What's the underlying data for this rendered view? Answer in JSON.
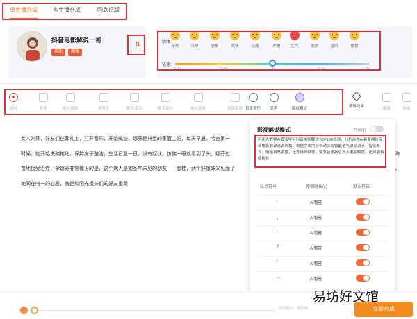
{
  "tabs": [
    "单主播合成",
    "多主播合成",
    "回到旧版"
  ],
  "profile": {
    "name": "抖音电影解说一哥",
    "badges": [
      "高能",
      "顺德"
    ],
    "swap_icon": "swap-arrows-icon"
  },
  "emotion": {
    "label": "情绪:",
    "items": [
      {
        "label": "亲切",
        "color": "#f5c242"
      },
      {
        "label": "冷静",
        "color": "#f5c242"
      },
      {
        "label": "恐惧",
        "color": "#f5c242"
      },
      {
        "label": "欢快",
        "color": "#f5c242"
      },
      {
        "label": "轻蔑",
        "color": "#f5c242"
      },
      {
        "label": "严肃",
        "color": "#f5c242"
      },
      {
        "label": "生气",
        "color": "#e9484d"
      },
      {
        "label": "悲伤",
        "color": "#f5c242"
      },
      {
        "label": "温柔",
        "color": "#f5c242"
      },
      {
        "label": "愉悦",
        "color": "#f5c242"
      }
    ],
    "selected_index": 6
  },
  "speed": {
    "label": "语速:",
    "ticks": [
      "0.1x",
      "0.5x",
      "1x",
      "1.5x",
      "2x"
    ],
    "value": "1x"
  },
  "toolbar": [
    {
      "label": "试听",
      "icon": "record-icon"
    },
    {
      "label": "暂停",
      "icon": "pause-icon"
    },
    {
      "label": "插入停顿",
      "icon": "insert-pause-icon"
    },
    {
      "label": "多音字",
      "icon": "polyphone-icon"
    },
    {
      "label": "数字读法",
      "icon": "number-icon"
    },
    {
      "label": "数字读法",
      "icon": "digit-icon"
    },
    {
      "label": "插入音效",
      "icon": "sound-effect-icon"
    },
    {
      "label": "局部变速",
      "icon": "speed-icon"
    },
    {
      "label": "背景音乐",
      "icon": "music-icon"
    },
    {
      "label": "变声",
      "icon": "voice-change-icon"
    },
    {
      "label": "解说模式",
      "icon": "commentary-icon"
    },
    {
      "label": "清除效果",
      "icon": "eraser-icon"
    },
    {
      "label": "撤销",
      "icon": "undo-icon"
    },
    {
      "label": "恢复",
      "icon": "redo-icon"
    }
  ],
  "content": {
    "lines": [
      "女人刚死，好友们在葬礼上，打开音乐，开始飙迪，娜芬是典型的家庭主妇，每天早晨，哈舍第一",
      "时候。她开始洗碗拖地，保持房子整洁，生活日复一日，没有起伏，仿佛一眼就看到了头。娜芬过",
      "苗地接受治疗，令娜芬非常惊讶的是，这个病人是她多年未见的朋友——春桂，两个好姐妹又见面了",
      "她同在唯一的心愿，就是和阳光姐妹们的好友重聚"
    ],
    "tail_1": "海",
    "tail_2": "，"
  },
  "popup": {
    "title": "影视解说模式",
    "toggle_label": "已关闭",
    "description": "利用大数据AI算法学习抖音电影解说TOP100视频，分析自然AI具备模仿专业电影解说语调风格，根据文案内容自动实现智能语气语调调节，智能断句，情绪自然调整，还支持停顿等，使发音更接近真人电影解说，还可能持续优化!",
    "columns": [
      "标点符号",
      "停顿时长(s)",
      "默认开启"
    ],
    "rows": [
      {
        "punct": ",",
        "pause": "AI智能"
      },
      {
        "punct": "。",
        "pause": "AI智能"
      },
      {
        "punct": "!",
        "pause": "AI智能"
      },
      {
        "punct": "?",
        "pause": "AI智能"
      },
      {
        "punct": "!",
        "pause": "AI智能"
      },
      {
        "punct": "…",
        "pause": "AI智能"
      }
    ]
  },
  "player": {
    "time_current": "00:00",
    "time_total": "00:00",
    "generate_label": "立即合成"
  },
  "watermark": "易坊好文馆",
  "colors": {
    "accent": "#f06a1c",
    "annotation": "#d9333a"
  }
}
